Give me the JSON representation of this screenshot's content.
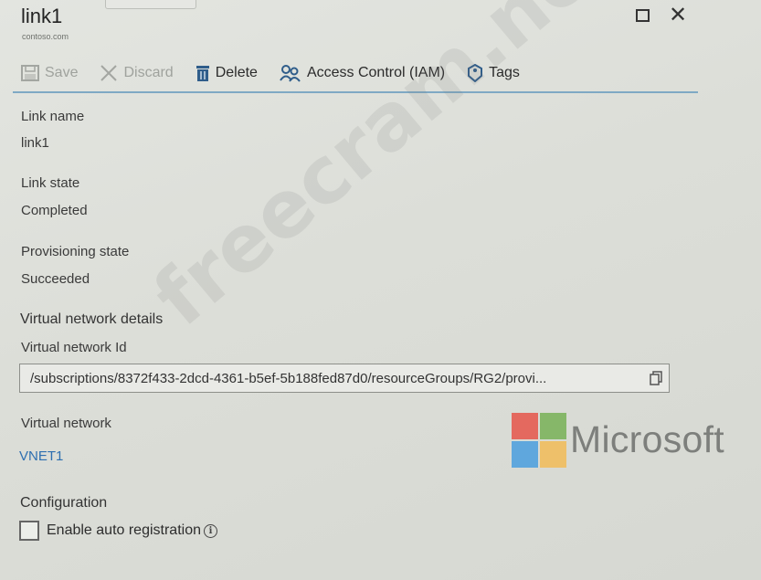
{
  "header": {
    "title": "link1",
    "subtitle": "contoso.com"
  },
  "toolbar": {
    "save_label": "Save",
    "discard_label": "Discard",
    "delete_label": "Delete",
    "access_control_label": "Access Control (IAM)",
    "tags_label": "Tags"
  },
  "fields": {
    "link_name_label": "Link name",
    "link_name_value": "link1",
    "link_state_label": "Link state",
    "link_state_value": "Completed",
    "provisioning_state_label": "Provisioning state",
    "provisioning_state_value": "Succeeded"
  },
  "vnet_details": {
    "section_title": "Virtual network details",
    "id_label": "Virtual network Id",
    "id_value": "/subscriptions/8372f433-2dcd-4361-b5ef-5b188fed87d0/resourceGroups/RG2/provi...",
    "vnet_label": "Virtual network",
    "vnet_value": "VNET1"
  },
  "configuration": {
    "section_title": "Configuration",
    "auto_registration_label": "Enable auto registration",
    "auto_registration_checked": false
  },
  "branding": {
    "microsoft_word": "Microsoft",
    "watermark": "freecram.net"
  },
  "colors": {
    "accent": "#7fa9c4",
    "link": "#2e6fb0"
  }
}
